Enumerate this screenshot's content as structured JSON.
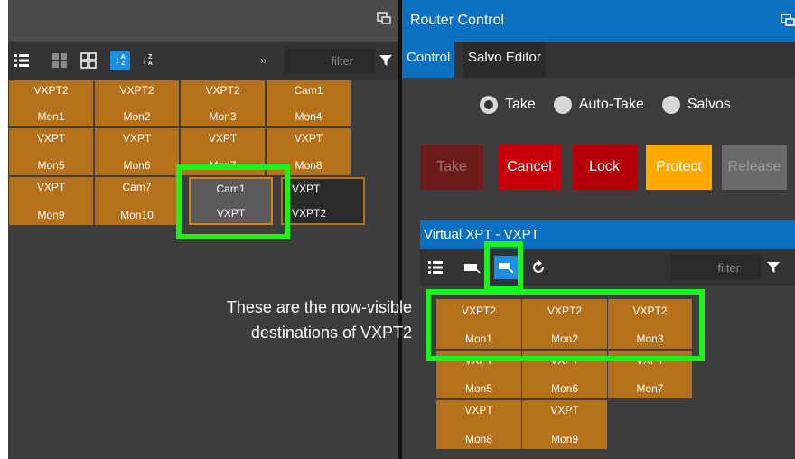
{
  "left_panel": {
    "toolbar": {
      "chevron": "»",
      "filter_placeholder": "filter"
    },
    "tiles": [
      {
        "source": "VXPT2",
        "dest": "Mon1"
      },
      {
        "source": "VXPT2",
        "dest": "Mon2"
      },
      {
        "source": "VXPT2",
        "dest": "Mon3"
      },
      {
        "source": "Cam1",
        "dest": "Mon4"
      },
      {
        "source": "VXPT",
        "dest": "Mon5"
      },
      {
        "source": "VXPT",
        "dest": "Mon6"
      },
      {
        "source": "VXPT",
        "dest": "Mon7"
      },
      {
        "source": "VXPT",
        "dest": "Mon8"
      },
      {
        "source": "VXPT",
        "dest": "Mon9"
      },
      {
        "source": "Cam7",
        "dest": "Mon10"
      },
      {
        "source": "Cam1",
        "dest": "VXPT"
      },
      {
        "source": "VXPT",
        "dest": "VXPT2"
      }
    ]
  },
  "right_panel": {
    "title": "Router Control",
    "tabs": [
      "Control",
      "Salvo Editor"
    ],
    "radio": {
      "options": [
        "Take",
        "Auto-Take",
        "Salvos"
      ],
      "selected": "Take"
    },
    "buttons": {
      "take": "Take",
      "cancel": "Cancel",
      "lock": "Lock",
      "protect": "Protect",
      "release": "Release"
    },
    "virtual": {
      "title": "Virtual XPT - VXPT",
      "filter_placeholder": "filter",
      "tiles": [
        {
          "source": "VXPT2",
          "dest": "Mon1"
        },
        {
          "source": "VXPT2",
          "dest": "Mon2"
        },
        {
          "source": "VXPT2",
          "dest": "Mon3"
        },
        {
          "source": "VXPT",
          "dest": "Mon5"
        },
        {
          "source": "VXPT",
          "dest": "Mon6"
        },
        {
          "source": "VXPT",
          "dest": "Mon7"
        },
        {
          "source": "VXPT",
          "dest": "Mon8"
        },
        {
          "source": "VXPT",
          "dest": "Mon9"
        }
      ]
    }
  },
  "annotation": {
    "line1": "These are the now-visible",
    "line2": "destinations of VXPT2"
  },
  "colors": {
    "tile": "#b5701b",
    "title_blue": "#0b6fc2",
    "highlight": "#1df21d",
    "cancel": "#c8000a",
    "lock": "#b4000a",
    "protect": "#ffa800",
    "take_disabled": "#6e1b1b",
    "release_disabled": "#6a6a6a"
  }
}
